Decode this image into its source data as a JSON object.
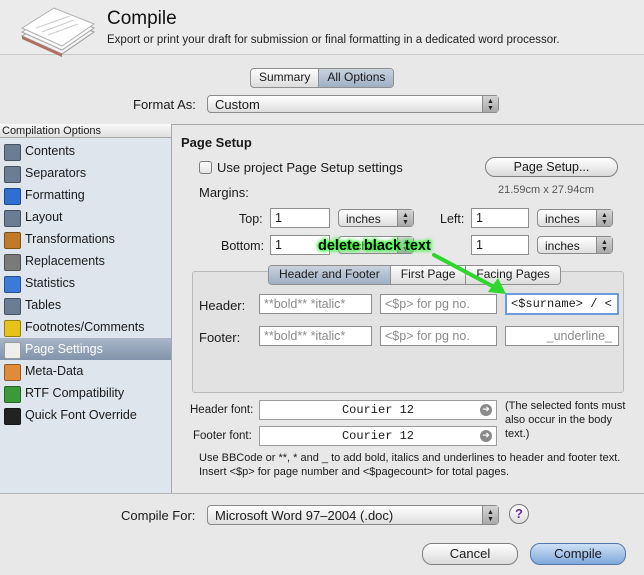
{
  "header": {
    "title": "Compile",
    "subtitle": "Export or print your draft for submission or final formatting in a dedicated word processor."
  },
  "view_toggle": {
    "summary": "Summary",
    "all_options": "All Options",
    "selected": "All Options"
  },
  "format_as": {
    "label": "Format As:",
    "value": "Custom"
  },
  "sidebar": {
    "header": "Compilation Options",
    "items": [
      {
        "label": "Contents",
        "icon": "contents-icon",
        "color": "#6a7d93"
      },
      {
        "label": "Separators",
        "icon": "separators-icon",
        "color": "#6a7d93"
      },
      {
        "label": "Formatting",
        "icon": "formatting-icon",
        "color": "#2f6fd0"
      },
      {
        "label": "Layout",
        "icon": "layout-icon",
        "color": "#6a7d93"
      },
      {
        "label": "Transformations",
        "icon": "transformations-icon",
        "color": "#c07a2a"
      },
      {
        "label": "Replacements",
        "icon": "replacements-icon",
        "color": "#7a7a7a"
      },
      {
        "label": "Statistics",
        "icon": "statistics-icon",
        "color": "#3b7ad8"
      },
      {
        "label": "Tables",
        "icon": "tables-icon",
        "color": "#6a7d93"
      },
      {
        "label": "Footnotes/Comments",
        "icon": "footnotes-icon",
        "color": "#e6c21a"
      },
      {
        "label": "Page Settings",
        "icon": "page-settings-icon",
        "color": "#eeeeee",
        "active": true
      },
      {
        "label": "Meta-Data",
        "icon": "meta-data-icon",
        "color": "#e08a3a"
      },
      {
        "label": "RTF Compatibility",
        "icon": "rtf-compatibility-icon",
        "color": "#3a9a3a"
      },
      {
        "label": "Quick Font Override",
        "icon": "font-override-icon",
        "color": "#222222"
      }
    ]
  },
  "page_setup": {
    "title": "Page Setup",
    "use_project_label": "Use project Page Setup settings",
    "use_project_checked": false,
    "page_setup_button": "Page Setup...",
    "paper_size": "21.59cm x 27.94cm",
    "margins_label": "Margins:",
    "top": {
      "label": "Top:",
      "value": "1",
      "unit": "inches"
    },
    "left": {
      "label": "Left:",
      "value": "1",
      "unit": "inches"
    },
    "bottom": {
      "label": "Bottom:",
      "value": "1",
      "unit": "inches"
    },
    "right": {
      "value": "1",
      "unit": "inches"
    }
  },
  "tabs": {
    "items": [
      "Header and Footer",
      "First Page",
      "Facing Pages"
    ],
    "selected": "Header and Footer"
  },
  "header_footer": {
    "header_label": "Header:",
    "footer_label": "Footer:",
    "header_left_placeholder": "**bold** *italic*",
    "header_center_placeholder": "<$p> for pg no.",
    "header_right_value": "<$surname> / <",
    "footer_left_placeholder": "**bold** *italic*",
    "footer_center_placeholder": "<$p> for pg no.",
    "footer_right_placeholder": "_underline_"
  },
  "annotation": "delete black text",
  "fonts": {
    "header_font_label": "Header font:",
    "header_font_value": "Courier 12",
    "footer_font_label": "Footer font:",
    "footer_font_value": "Courier 12",
    "note": "(The selected fonts must also occur in the body text.)"
  },
  "help_text": "Use BBCode or **, * and _ to add bold, italics and underlines to header and footer text. Insert <$p> for page number and <$pagecount> for total pages.",
  "compile_for": {
    "label": "Compile For:",
    "value": "Microsoft Word 97–2004 (.doc)"
  },
  "buttons": {
    "help": "?",
    "cancel": "Cancel",
    "compile": "Compile"
  },
  "colors": {
    "annotation_glow": "#3aff3a",
    "annotation_arrow": "#2ed62e",
    "selection": "#8193ab",
    "default_button": "#7fa8dc"
  }
}
